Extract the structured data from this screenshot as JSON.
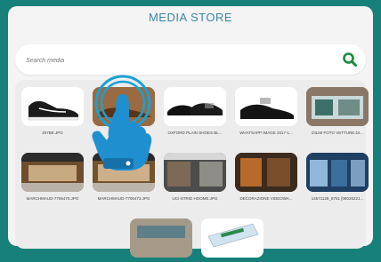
{
  "header": {
    "title": "MEDIA STORE"
  },
  "search": {
    "placeholder": "Search media"
  },
  "colors": {
    "background": "#17807b",
    "accent": "#3a86a6",
    "search_icon": "#1e8a3c"
  },
  "media": [
    {
      "file": "207BE.JPG",
      "icon": "sneaker-image"
    },
    {
      "file": "",
      "icon": "shoe-image"
    },
    {
      "file": "OXFORD PLAIN SHOES BL...",
      "icon": "oxford-shoes-image"
    },
    {
      "file": "WHATSAPP IMAGE 2017-1...",
      "icon": "dress-shoe-image"
    },
    {
      "file": "DILMI FOTO VETTURE.DI...",
      "icon": "storefront-image"
    },
    {
      "file": "MARCHMAUD-7706470.JPG",
      "icon": "store-interior-image"
    },
    {
      "file": "MARCHMAUD-7706473.JPG",
      "icon": "store-interior-image"
    },
    {
      "file": "UCI-STRID HOOME.JPG",
      "icon": "store-aisle-image"
    },
    {
      "file": "DECORAZIONE VIDEOWA...",
      "icon": "video-wall-image"
    },
    {
      "file": "14571128_8751 [08026221...",
      "icon": "storefront-image"
    },
    {
      "file": "",
      "icon": "display-image"
    },
    {
      "file": "",
      "icon": "screen-image"
    }
  ]
}
